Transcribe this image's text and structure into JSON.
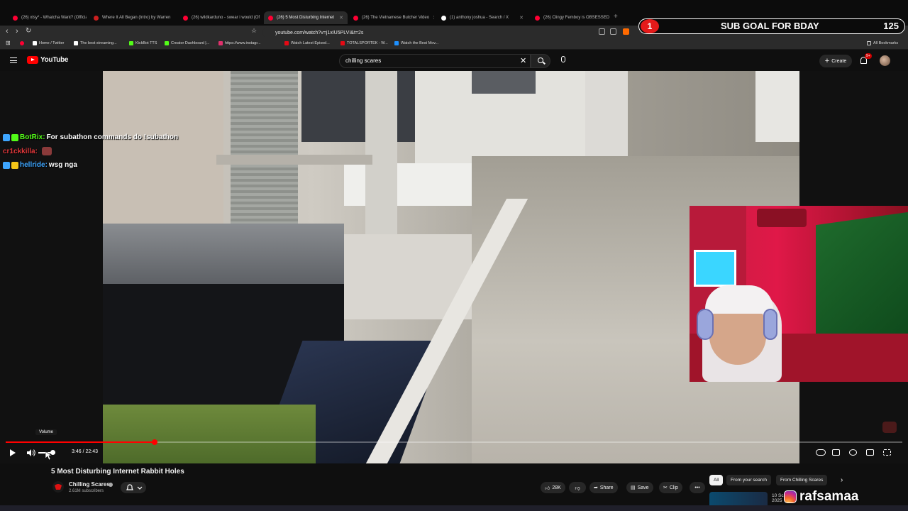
{
  "browser": {
    "tabs": [
      {
        "label": "(26) xtsy* - Whatcha Want? (Official",
        "active": false,
        "color": "#ff0033"
      },
      {
        "label": "Where It All Began (Intro) by Warren",
        "active": false,
        "color": "#cc1f1f"
      },
      {
        "label": "(26) wildkarduno - swear i would (Of",
        "active": false,
        "color": "#ff0033"
      },
      {
        "label": "(26) 5 Most Disturbing Internet",
        "active": true,
        "color": "#ff0033"
      },
      {
        "label": "(26) The Vietnamese Butcher Video",
        "active": false,
        "color": "#ff0033"
      },
      {
        "label": "(1) anthony joshua - Search / X",
        "active": false,
        "color": "#ffffff"
      },
      {
        "label": "(26) Clingy Femboy is OBSESSED W",
        "active": false,
        "color": "#ff0033"
      }
    ],
    "url": "youtube.com/watch?v=j1xIU5PLVI&t=2s",
    "bookmarks": [
      {
        "label": "Home / Twitter",
        "color": "#ffffff"
      },
      {
        "label": "The best streaming...",
        "color": "#ffffff"
      },
      {
        "label": "KickBot TTS",
        "color": "#53fc18"
      },
      {
        "label": "Creator Dashboard |...",
        "color": "#53fc18"
      },
      {
        "label": "https://www.instagr...",
        "color": "#e1306c"
      },
      {
        "label": "Watch Latest Episod...",
        "color": "#e50914"
      },
      {
        "label": "TOTALSPORTEK - W...",
        "color": "#e50914"
      },
      {
        "label": "Watch the Best Mov...",
        "color": "#1e90ff"
      }
    ],
    "all_bookmarks": "All Bookmarks"
  },
  "overlay": {
    "sub_goal_title": "SUB GOAL FOR BDAY",
    "sub_goal_current": "1",
    "sub_goal_target": "125",
    "chat": [
      {
        "name": "BotRix:",
        "message": "For subathon commands do !subathon",
        "name_color": "#53fc18"
      },
      {
        "name": "cr1ckkilla:",
        "message": "",
        "name_color": "#e0373a"
      },
      {
        "name": "hellride:",
        "message": "wsg nga",
        "name_color": "#3ea6ff"
      }
    ],
    "watermark": "rafsamaa"
  },
  "youtube": {
    "logo_text": "YouTube",
    "search_value": "chilling scares",
    "create_label": "Create",
    "notification_badge": "9+"
  },
  "player": {
    "current_time": "3:46",
    "duration": "22:43",
    "time_display": "3:46 / 22:43",
    "progress_fraction": 0.166,
    "volume_tooltip": "Volume",
    "volume_fraction": 0.85
  },
  "video": {
    "title": "5 Most Disturbing Internet Rabbit Holes",
    "channel": "Chilling Scares",
    "subscribers": "2.61M subscribers",
    "like_count": "28K",
    "share_label": "Share",
    "save_label": "Save",
    "clip_label": "Clip"
  },
  "recommendations": {
    "chips": [
      "All",
      "From your search",
      "From Chilling Scares"
    ],
    "first_title": "10 Scar...",
    "first_year": "2025"
  }
}
